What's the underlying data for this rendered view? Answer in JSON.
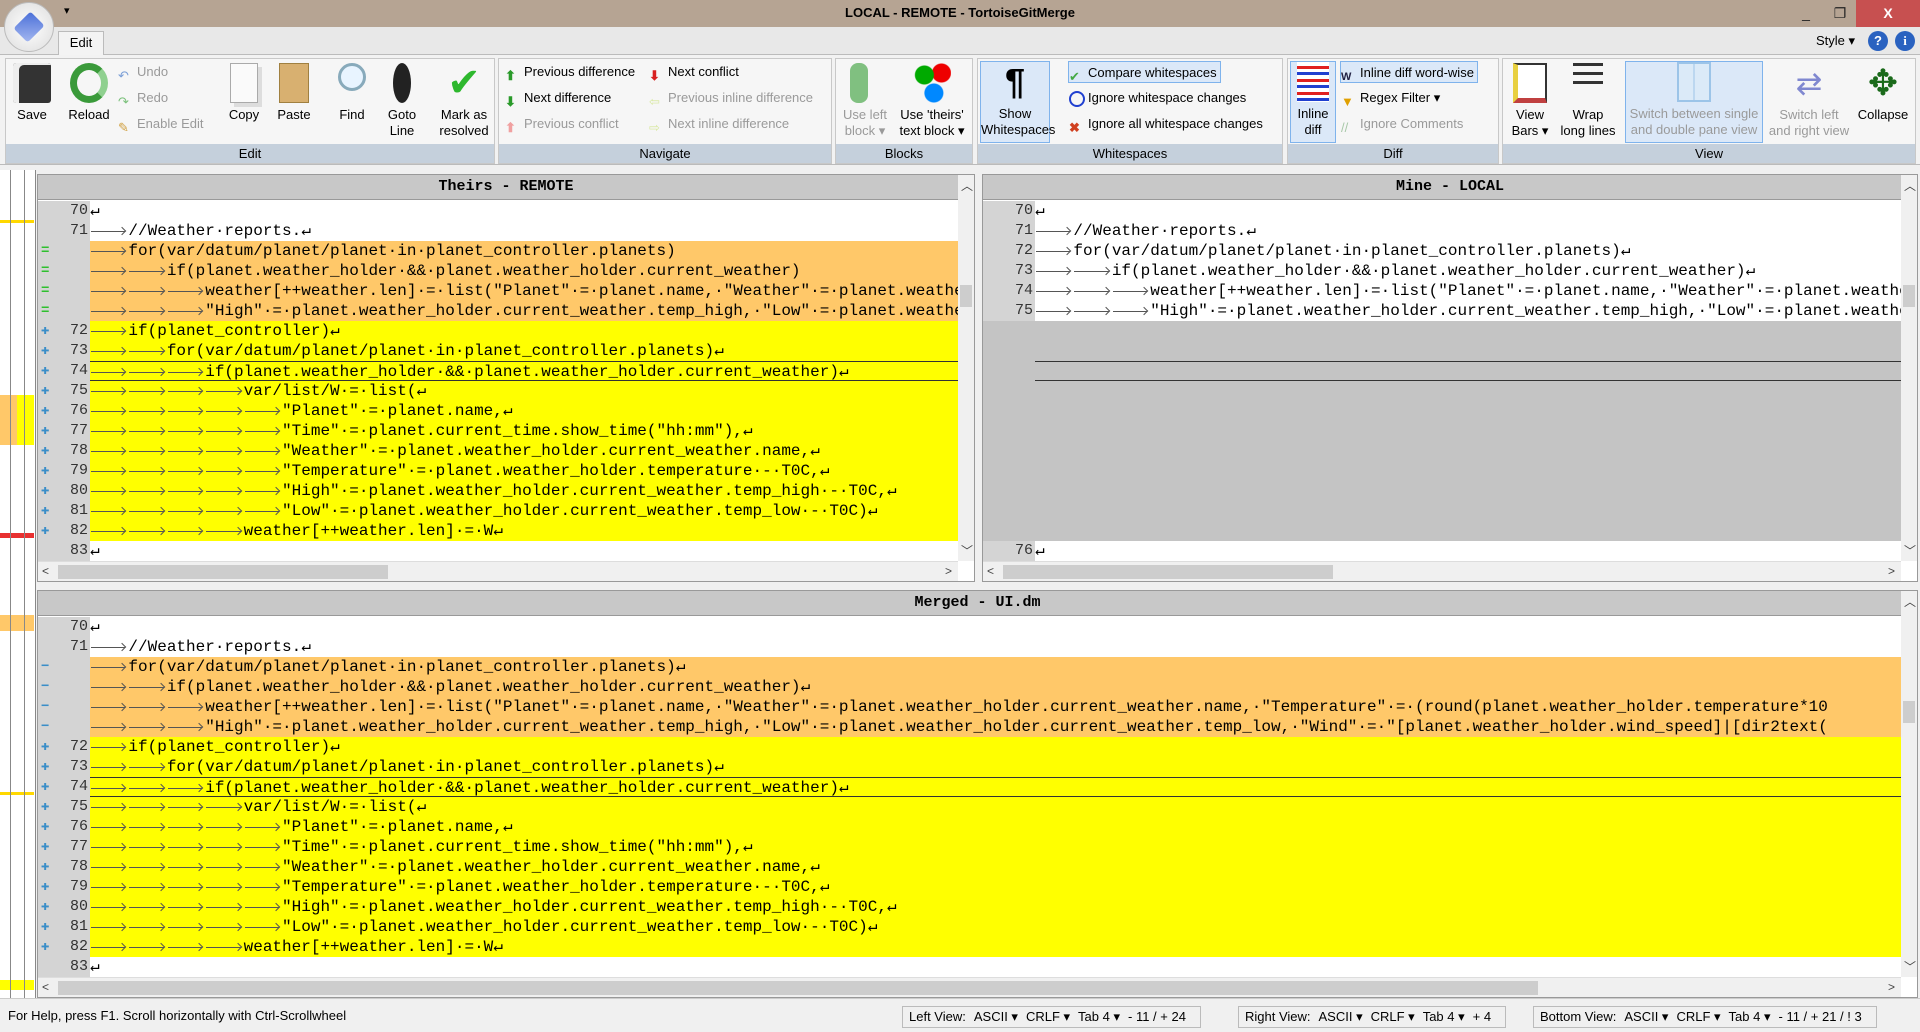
{
  "window": {
    "title": "LOCAL - REMOTE - TortoiseGitMerge",
    "minimize": "_",
    "maximize": "❐",
    "close": "X",
    "quick_access": "▾"
  },
  "tabs": {
    "edit": "Edit",
    "style": "Style ▾",
    "help": "?",
    "about": "i"
  },
  "ribbon": {
    "edit": {
      "label": "Edit",
      "save": "Save",
      "reload": "Reload",
      "undo": "Undo",
      "redo": "Redo",
      "enable_edit": "Enable Edit",
      "copy": "Copy",
      "paste": "Paste",
      "find": "Find",
      "goto_line": "Goto\nLine",
      "mark_resolved": "Mark as\nresolved"
    },
    "navigate": {
      "label": "Navigate",
      "prev_diff": "Previous difference",
      "next_diff": "Next difference",
      "prev_conflict": "Previous conflict",
      "next_conflict": "Next conflict",
      "prev_inline": "Previous inline difference",
      "next_inline": "Next inline difference"
    },
    "blocks": {
      "label": "Blocks",
      "use_left": "Use left\nblock ▾",
      "use_theirs": "Use 'theirs'\ntext block ▾"
    },
    "whitespaces": {
      "label": "Whitespaces",
      "show": "Show\nWhitespaces",
      "compare": "Compare whitespaces",
      "ignore_changes": "Ignore whitespace changes",
      "ignore_all": "Ignore all whitespace changes"
    },
    "diff": {
      "label": "Diff",
      "inline": "Inline\ndiff",
      "inline_word": "Inline diff word-wise",
      "regex": "Regex Filter ▾",
      "ignore_comments": "Ignore Comments"
    },
    "view": {
      "label": "View",
      "view_bars": "View\nBars ▾",
      "wrap": "Wrap\nlong lines",
      "switch_pane": "Switch between single\nand double pane view",
      "switch_lr": "Switch left\nand right view",
      "collapse": "Collapse"
    }
  },
  "colors": {
    "conflict_orange": "#ffc869",
    "added_yellow": "#ffff00",
    "empty_gray": "#c4c4c4",
    "gutter": "#d4d4d4"
  },
  "theirs": {
    "title": "Theirs - REMOTE",
    "lines": [
      {
        "n": "70",
        "t": "↵",
        "k": "white"
      },
      {
        "n": "71",
        "t": "\t//Weather·reports.↵",
        "k": "white"
      },
      {
        "n": "",
        "t": "\tfor(var/datum/planet/planet·in·planet_controller.planets)",
        "k": "orange",
        "g": "equal-icon"
      },
      {
        "n": "",
        "t": "\t\tif(planet.weather_holder·&&·planet.weather_holder.current_weather)",
        "k": "orange",
        "g": "equal-icon"
      },
      {
        "n": "",
        "t": "\t\t\tweather[++weather.len]·=·list(\"Planet\"·=·planet.name,·\"Weather\"·=·planet.weather_holder.current_weather.name,",
        "k": "orange",
        "g": "equal-icon"
      },
      {
        "n": "",
        "t": "\t\t\t\"High\"·=·planet.weather_holder.current_weather.temp_high,·\"Low\"·=·planet.weather_holder.current_weather.temp_low,",
        "k": "orange",
        "g": "equal-icon"
      },
      {
        "n": "72",
        "t": "\tif(planet_controller)↵",
        "k": "yellow",
        "g": "plus-icon"
      },
      {
        "n": "73",
        "t": "\t\tfor(var/datum/planet/planet·in·planet_controller.planets)↵",
        "k": "yellow",
        "g": "plus-icon"
      },
      {
        "n": "74",
        "t": "\t\t\tif(planet.weather_holder·&&·planet.weather_holder.current_weather)↵",
        "k": "yellow box",
        "g": "plus-icon"
      },
      {
        "n": "75",
        "t": "\t\t\t\tvar/list/W·=·list(↵",
        "k": "yellow",
        "g": "plus-icon"
      },
      {
        "n": "76",
        "t": "\t\t\t\t\t\"Planet\"·=·planet.name,↵",
        "k": "yellow",
        "g": "plus-icon"
      },
      {
        "n": "77",
        "t": "\t\t\t\t\t\"Time\"·=·planet.current_time.show_time(\"hh:mm\"),↵",
        "k": "yellow",
        "g": "plus-icon"
      },
      {
        "n": "78",
        "t": "\t\t\t\t\t\"Weather\"·=·planet.weather_holder.current_weather.name,↵",
        "k": "yellow",
        "g": "plus-icon"
      },
      {
        "n": "79",
        "t": "\t\t\t\t\t\"Temperature\"·=·planet.weather_holder.temperature·-·T0C,↵",
        "k": "yellow",
        "g": "plus-icon"
      },
      {
        "n": "80",
        "t": "\t\t\t\t\t\"High\"·=·planet.weather_holder.current_weather.temp_high·-·T0C,↵",
        "k": "yellow",
        "g": "plus-icon"
      },
      {
        "n": "81",
        "t": "\t\t\t\t\t\"Low\"·=·planet.weather_holder.current_weather.temp_low·-·T0C)↵",
        "k": "yellow",
        "g": "plus-icon"
      },
      {
        "n": "82",
        "t": "\t\t\t\tweather[++weather.len]·=·W↵",
        "k": "yellow",
        "g": "plus-icon"
      },
      {
        "n": "83",
        "t": "↵",
        "k": "white"
      }
    ]
  },
  "mine": {
    "title": "Mine - LOCAL",
    "lines": [
      {
        "n": "70",
        "t": "↵",
        "k": "white"
      },
      {
        "n": "71",
        "t": "\t//Weather·reports.↵",
        "k": "white"
      },
      {
        "n": "72",
        "t": "\tfor(var/datum/planet/planet·in·planet_controller.planets)↵",
        "k": "white"
      },
      {
        "n": "73",
        "t": "\t\tif(planet.weather_holder·&&·planet.weather_holder.current_weather)↵",
        "k": "white"
      },
      {
        "n": "74",
        "t": "\t\t\tweather[++weather.len]·=·list(\"Planet\"·=·planet.name,·\"Weather\"·=·planet.weather_holder.current_weather.name,",
        "k": "white"
      },
      {
        "n": "75",
        "t": "\t\t\t\"High\"·=·planet.weather_holder.current_weather.temp_high,·\"Low\"·=·planet.weather_holder.current_weather.temp_low,",
        "k": "white"
      },
      {
        "n": "",
        "t": "",
        "k": "gray"
      },
      {
        "n": "",
        "t": "",
        "k": "gray"
      },
      {
        "n": "",
        "t": "",
        "k": "gray box"
      },
      {
        "n": "",
        "t": "",
        "k": "gray"
      },
      {
        "n": "",
        "t": "",
        "k": "gray"
      },
      {
        "n": "",
        "t": "",
        "k": "gray"
      },
      {
        "n": "",
        "t": "",
        "k": "gray"
      },
      {
        "n": "",
        "t": "",
        "k": "gray"
      },
      {
        "n": "",
        "t": "",
        "k": "gray"
      },
      {
        "n": "",
        "t": "",
        "k": "gray"
      },
      {
        "n": "",
        "t": "",
        "k": "gray"
      },
      {
        "n": "76",
        "t": "↵",
        "k": "white"
      }
    ]
  },
  "merged": {
    "title": "Merged - UI.dm",
    "lines": [
      {
        "n": "70",
        "t": "↵",
        "k": "white"
      },
      {
        "n": "71",
        "t": "\t//Weather·reports.↵",
        "k": "white"
      },
      {
        "n": "",
        "t": "\tfor(var/datum/planet/planet·in·planet_controller.planets)↵",
        "k": "orange",
        "g": "minus-icon"
      },
      {
        "n": "",
        "t": "\t\tif(planet.weather_holder·&&·planet.weather_holder.current_weather)↵",
        "k": "orange",
        "g": "minus-icon"
      },
      {
        "n": "",
        "t": "\t\t\tweather[++weather.len]·=·list(\"Planet\"·=·planet.name,·\"Weather\"·=·planet.weather_holder.current_weather.name,·\"Temperature\"·=·(round(planet.weather_holder.temperature*10",
        "k": "orange",
        "g": "minus-icon"
      },
      {
        "n": "",
        "t": "\t\t\t\"High\"·=·planet.weather_holder.current_weather.temp_high,·\"Low\"·=·planet.weather_holder.current_weather.temp_low,·\"Wind\"·=·\"[planet.weather_holder.wind_speed]|[dir2text(",
        "k": "orange",
        "g": "minus-icon"
      },
      {
        "n": "72",
        "t": "\tif(planet_controller)↵",
        "k": "yellow",
        "g": "plus-icon"
      },
      {
        "n": "73",
        "t": "\t\tfor(var/datum/planet/planet·in·planet_controller.planets)↵",
        "k": "yellow",
        "g": "plus-icon"
      },
      {
        "n": "74",
        "t": "\t\t\tif(planet.weather_holder·&&·planet.weather_holder.current_weather)↵",
        "k": "yellow box",
        "g": "plus-icon"
      },
      {
        "n": "75",
        "t": "\t\t\t\tvar/list/W·=·list(↵",
        "k": "yellow",
        "g": "plus-icon"
      },
      {
        "n": "76",
        "t": "\t\t\t\t\t\"Planet\"·=·planet.name,↵",
        "k": "yellow",
        "g": "plus-icon"
      },
      {
        "n": "77",
        "t": "\t\t\t\t\t\"Time\"·=·planet.current_time.show_time(\"hh:mm\"),↵",
        "k": "yellow",
        "g": "plus-icon"
      },
      {
        "n": "78",
        "t": "\t\t\t\t\t\"Weather\"·=·planet.weather_holder.current_weather.name,↵",
        "k": "yellow",
        "g": "plus-icon"
      },
      {
        "n": "79",
        "t": "\t\t\t\t\t\"Temperature\"·=·planet.weather_holder.temperature·-·T0C,↵",
        "k": "yellow",
        "g": "plus-icon"
      },
      {
        "n": "80",
        "t": "\t\t\t\t\t\"High\"·=·planet.weather_holder.current_weather.temp_high·-·T0C,↵",
        "k": "yellow",
        "g": "plus-icon"
      },
      {
        "n": "81",
        "t": "\t\t\t\t\t\"Low\"·=·planet.weather_holder.current_weather.temp_low·-·T0C)↵",
        "k": "yellow",
        "g": "plus-icon"
      },
      {
        "n": "82",
        "t": "\t\t\t\tweather[++weather.len]·=·W↵",
        "k": "yellow",
        "g": "plus-icon"
      },
      {
        "n": "83",
        "t": "↵",
        "k": "white"
      }
    ]
  },
  "status": {
    "help": "For Help, press F1. Scroll horizontally with Ctrl-Scrollwheel",
    "left": {
      "label": "Left View:",
      "encoding": "ASCII ▾",
      "eol": "CRLF ▾",
      "tab": "Tab 4 ▾",
      "counts": "- 11 / + 24"
    },
    "right": {
      "label": "Right View:",
      "encoding": "ASCII ▾",
      "eol": "CRLF ▾",
      "tab": "Tab 4 ▾",
      "counts": "+ 4"
    },
    "bottom": {
      "label": "Bottom View:",
      "encoding": "ASCII ▾",
      "eol": "CRLF ▾",
      "tab": "Tab 4 ▾",
      "counts": "- 11 / + 21 / ! 3"
    }
  }
}
